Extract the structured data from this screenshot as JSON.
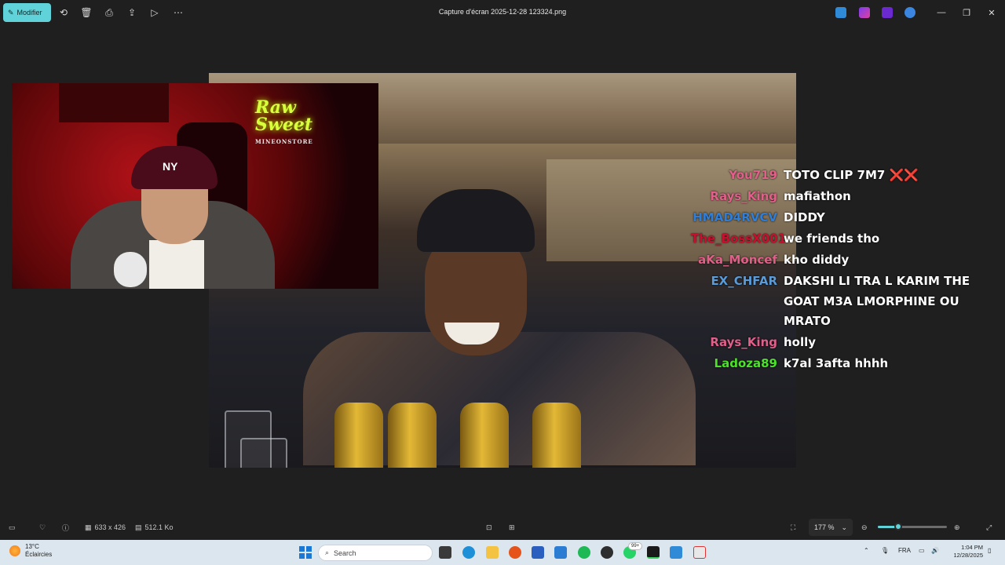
{
  "titlebar": {
    "edit_label": "Modifier",
    "file_title": "Capture d'écran 2025-12-28 123324.png",
    "icons": [
      "rotate-icon",
      "delete-icon",
      "print-icon",
      "share-icon",
      "slideshow-icon",
      "more-icon"
    ],
    "window_controls": [
      "minimize-icon",
      "maximize-icon",
      "close-icon"
    ]
  },
  "overlay": {
    "brand_neon": "Raw Sweet",
    "brand_sub": "MINEONSTORE",
    "cap_logo": "NY"
  },
  "chat": [
    {
      "user": "You719",
      "color": "#e0608a",
      "message": "TOTO CLIP 7M7 ❌❌"
    },
    {
      "user": "Rays_King",
      "color": "#e0608a",
      "message": "mafiathon"
    },
    {
      "user": "HMAD4RVCV",
      "color": "#2f7fd8",
      "message": "DIDDY"
    },
    {
      "user": "The_BossX001",
      "color": "#c8102e",
      "message": "we friends tho"
    },
    {
      "user": "aKa_Moncef",
      "color": "#e0608a",
      "message": "kho diddy"
    },
    {
      "user": "EX_CHFAR",
      "color": "#5a9bd8",
      "message": "DAKSHI LI TRA L KARIM THE GOAT M3A LMORPHINE OU MRATO"
    },
    {
      "user": "Rays_King",
      "color": "#e0608a",
      "message": "holly"
    },
    {
      "user": "Ladoza89",
      "color": "#4ce22a",
      "message": "k7al 3afta hhhh"
    }
  ],
  "bottombar": {
    "dimensions": "633 x 426",
    "filesize": "512.1 Ko",
    "zoom": "177 %",
    "zoom_level_fraction": 0.3
  },
  "taskbar": {
    "temperature": "13°C",
    "weather": "Éclaircies",
    "search_placeholder": "Search",
    "whatsapp_badge": "99+",
    "language": "FRA",
    "time": "1:04 PM",
    "date": "12/28/2025"
  },
  "colors": {
    "accent": "#5fd3d9",
    "background": "#1f1f1f",
    "taskbar": "#dbe6ef"
  }
}
